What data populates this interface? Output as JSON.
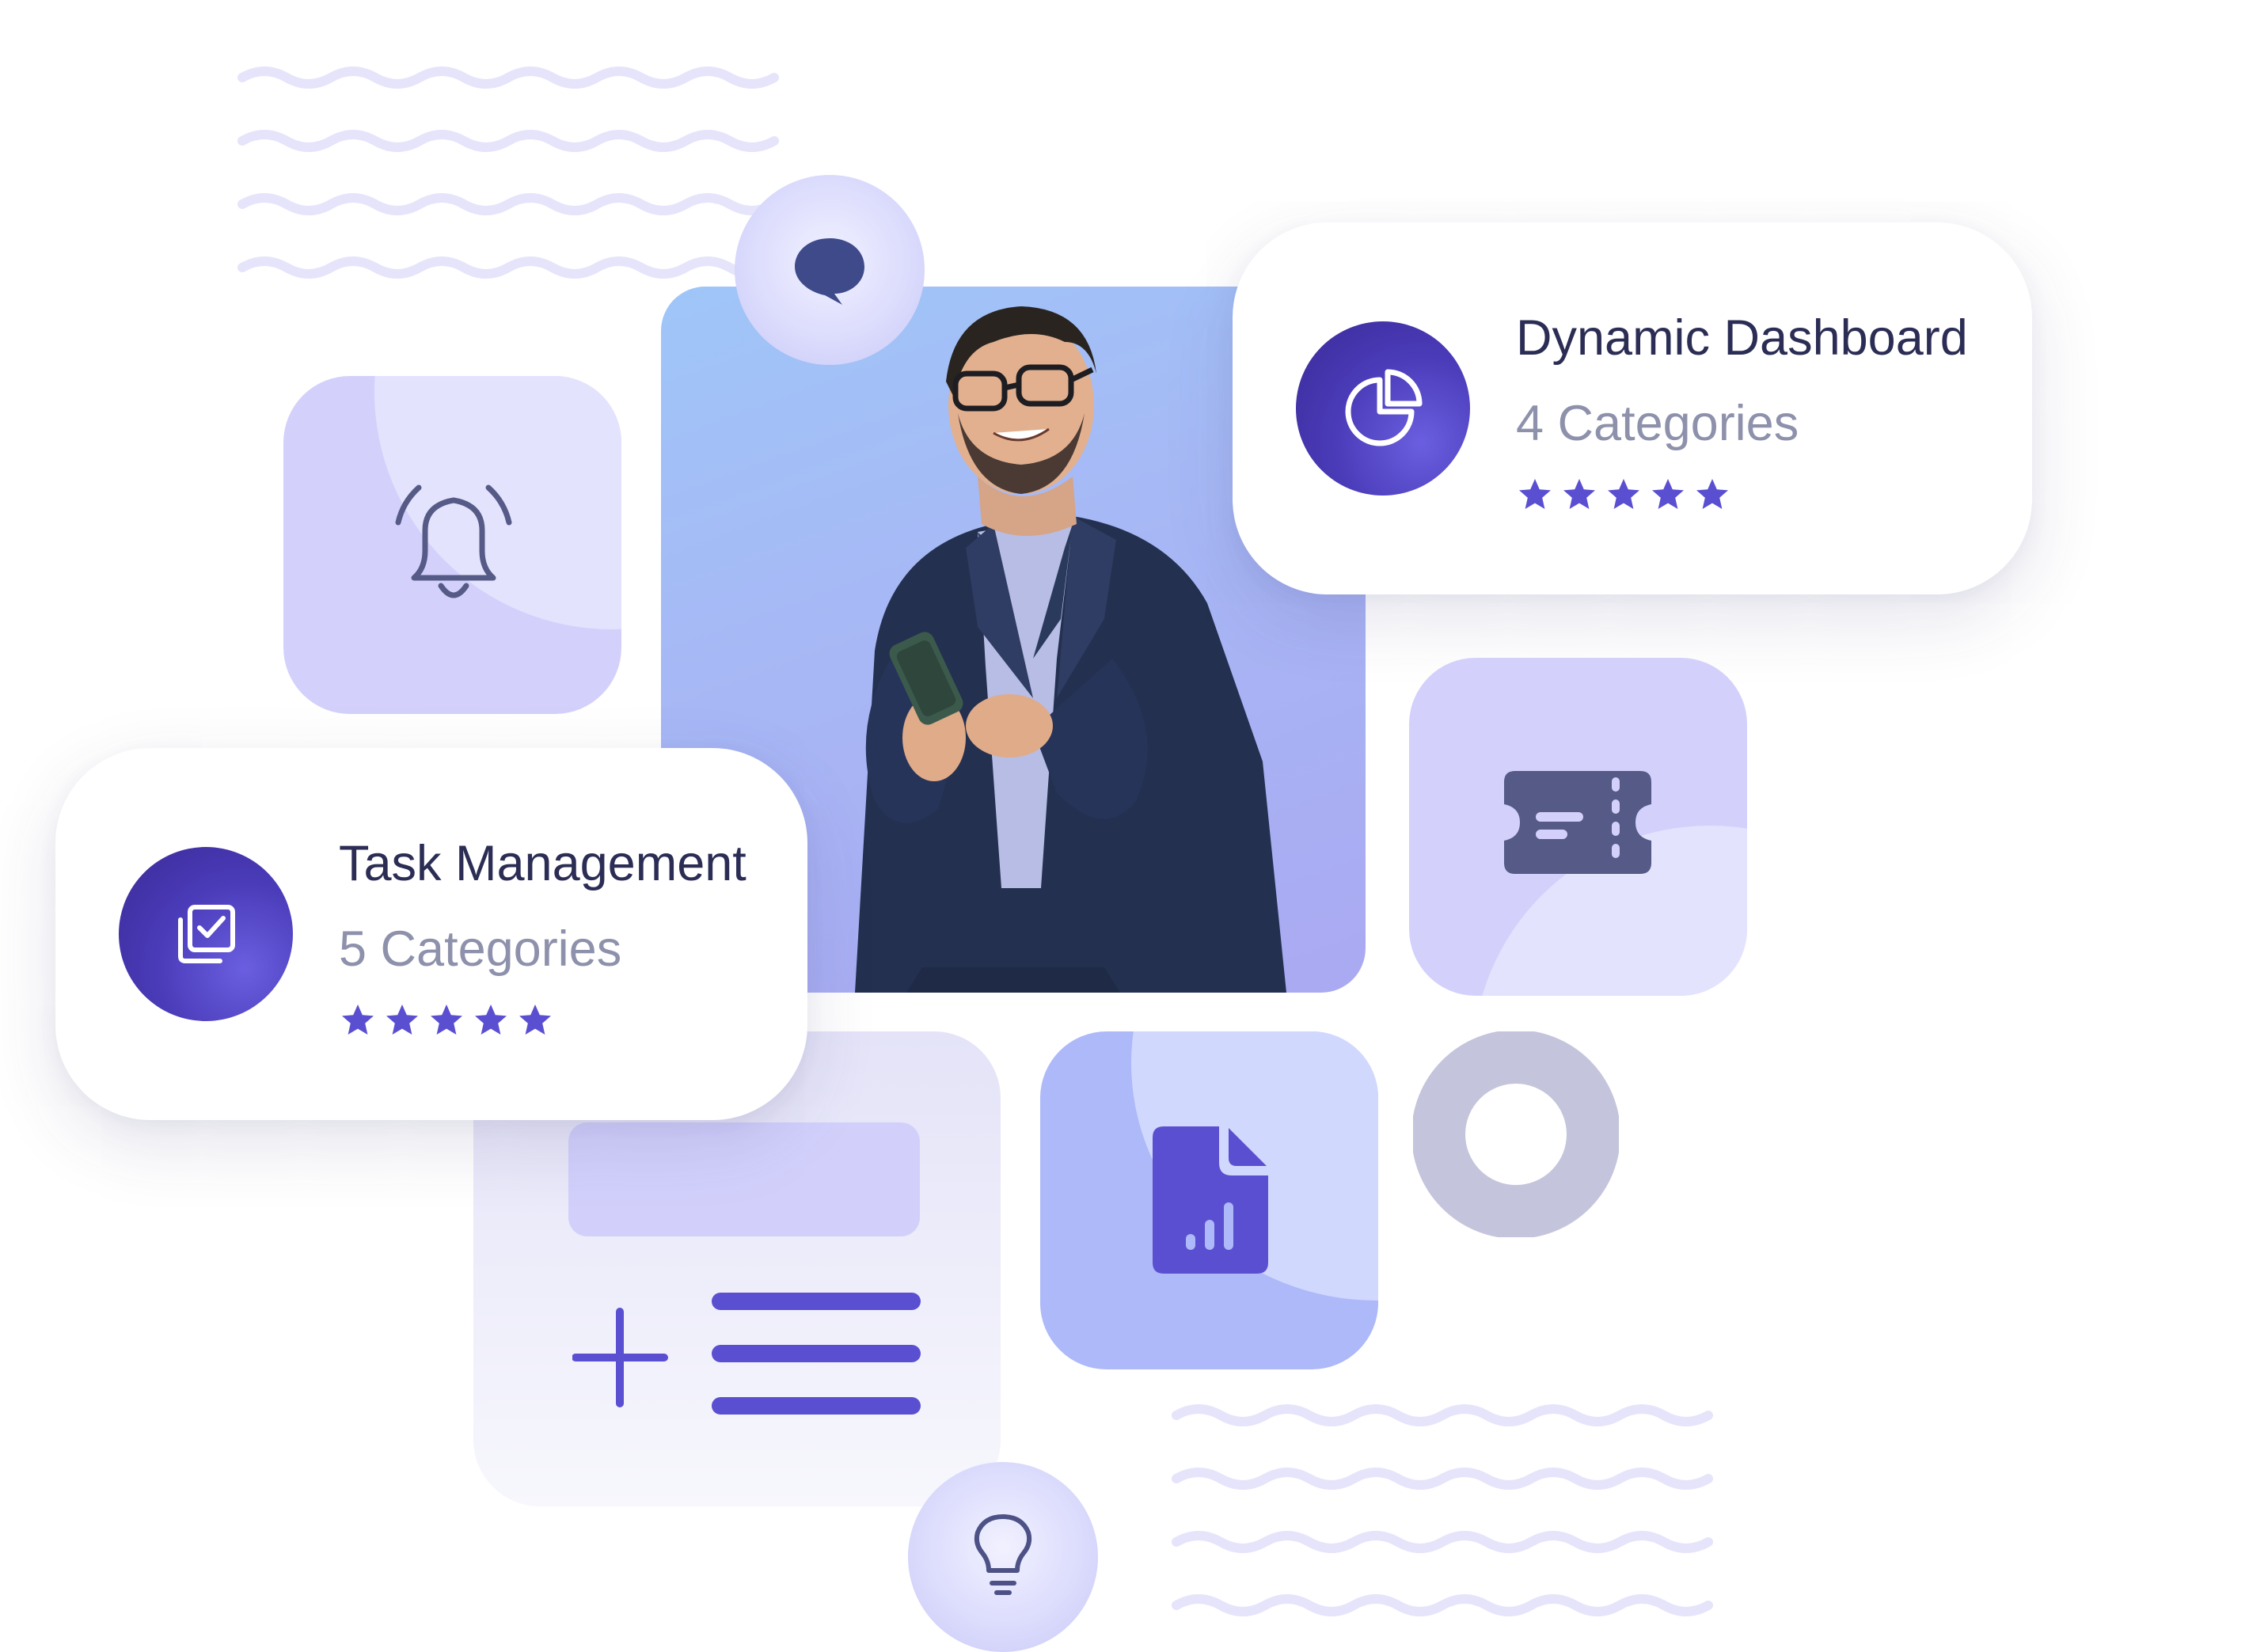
{
  "colors": {
    "accent": "#5b4fd1",
    "accent_dark": "#3a2a97",
    "tile_light": "#d2d0fb",
    "wave": "#e5e4fb",
    "title_text": "#2b2d55",
    "sub_text": "#8e91ab"
  },
  "cards": [
    {
      "title": "Dynamic Dashboard",
      "subtitle": "4 Categories",
      "rating": 5,
      "icon": "pie-chart-icon"
    },
    {
      "title": "Task Management",
      "subtitle": "5 Categories",
      "rating": 5,
      "icon": "task-checklist-icon"
    }
  ],
  "icons": {
    "bell": "bell-icon",
    "chat": "chat-bubble-icon",
    "ticket": "ticket-icon",
    "report": "report-file-icon",
    "ring": "ring-icon",
    "add_list": "add-list-icon",
    "lightbulb": "lightbulb-icon"
  }
}
